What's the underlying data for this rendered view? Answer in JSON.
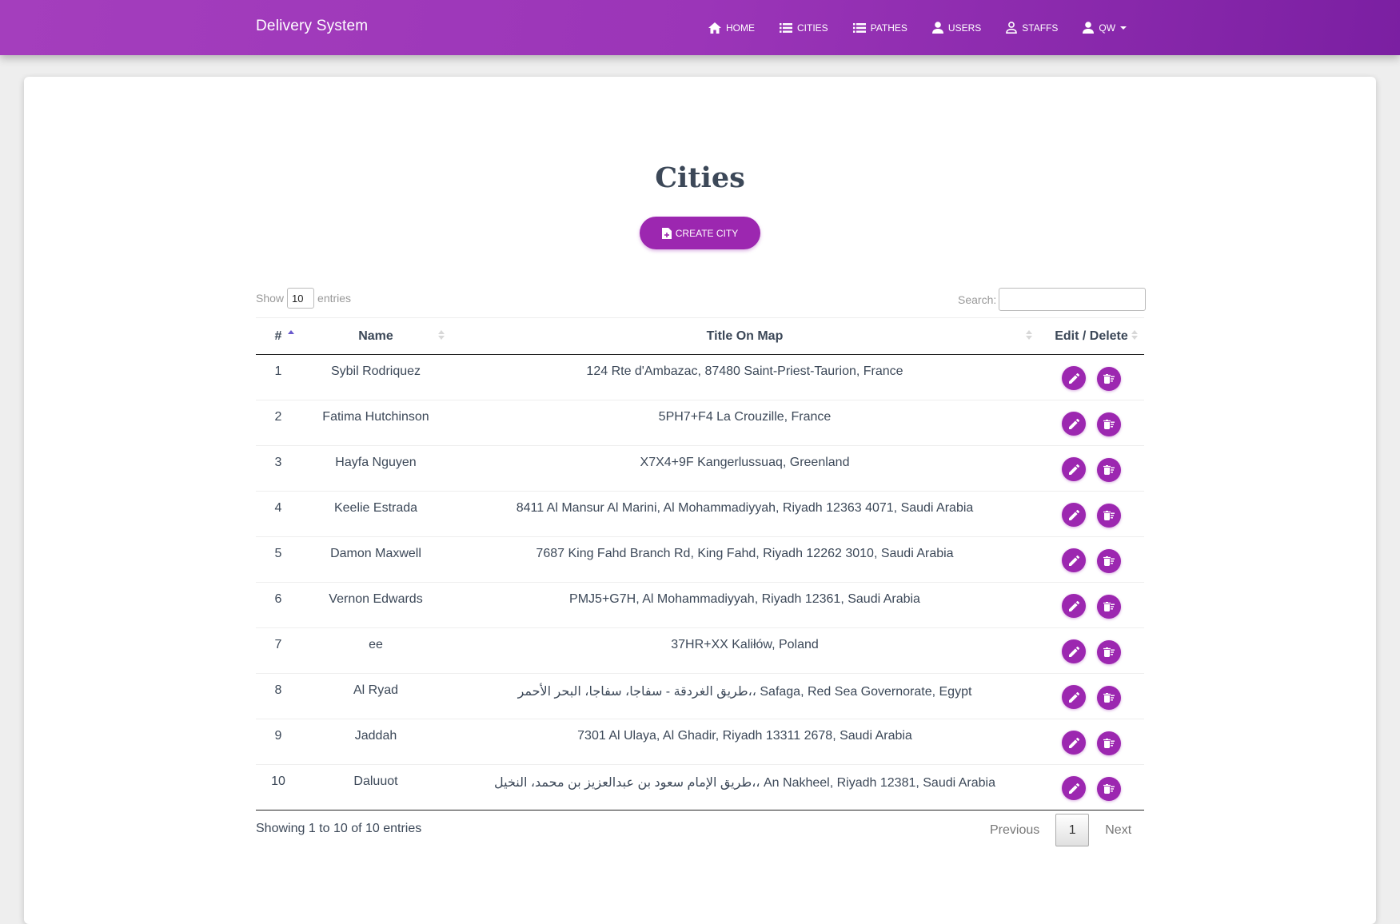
{
  "navbar": {
    "brand": "Delivery System",
    "items": [
      {
        "label": "HOME",
        "icon": "home-icon"
      },
      {
        "label": "CITIES",
        "icon": "list-icon"
      },
      {
        "label": "PATHES",
        "icon": "list-icon"
      },
      {
        "label": "USERS",
        "icon": "person-icon"
      },
      {
        "label": "STAFFS",
        "icon": "person-outline-icon"
      },
      {
        "label": "QW",
        "icon": "person-icon"
      }
    ]
  },
  "page": {
    "title": "Cities",
    "create_button": "CREATE CITY"
  },
  "controls": {
    "show_label": "Show",
    "entries_value": "10",
    "entries_label": "entries",
    "search_label": "Search:",
    "search_value": ""
  },
  "table": {
    "headers": [
      "#",
      "Name",
      "Title On Map",
      "Edit / Delete"
    ],
    "rows": [
      {
        "idx": "1",
        "name": "Sybil Rodriquez",
        "title": "124 Rte d'Ambazac, 87480 Saint-Priest-Taurion, France"
      },
      {
        "idx": "2",
        "name": "Fatima Hutchinson",
        "title": "5PH7+F4 La Crouzille, France"
      },
      {
        "idx": "3",
        "name": "Hayfa Nguyen",
        "title": "X7X4+9F Kangerlussuaq, Greenland"
      },
      {
        "idx": "4",
        "name": "Keelie Estrada",
        "title": "8411 Al Mansur Al Marini, Al Mohammadiyyah, Riyadh 12363 4071, Saudi Arabia"
      },
      {
        "idx": "5",
        "name": "Damon Maxwell",
        "title": "7687 King Fahd Branch Rd, King Fahd, Riyadh 12262 3010, Saudi Arabia"
      },
      {
        "idx": "6",
        "name": "Vernon Edwards",
        "title": "PMJ5+G7H, Al Mohammadiyyah, Riyadh 12361, Saudi Arabia"
      },
      {
        "idx": "7",
        "name": "ee",
        "title": "37HR+XX Kaliłów, Poland"
      },
      {
        "idx": "8",
        "name": "Al Ryad",
        "title": "طريق الغردقة - سفاجا، سفاجا، البحر الأحمر،، Safaga, Red Sea Governorate, Egypt"
      },
      {
        "idx": "9",
        "name": "Jaddah",
        "title": "7301 Al Ulaya, Al Ghadir, Riyadh 13311 2678, Saudi Arabia"
      },
      {
        "idx": "10",
        "name": "Daluuot",
        "title": "طريق الإمام سعود بن عبدالعزيز بن محمد، النخيل،، An Nakheel, Riyadh 12381, Saudi Arabia"
      }
    ]
  },
  "footer": {
    "info": "Showing 1 to 10 of 10 entries",
    "previous": "Previous",
    "current_page": "1",
    "next": "Next"
  },
  "colors": {
    "primary": "#9c27b0",
    "navbar_start": "#a43ebd",
    "navbar_end": "#7b1fa2",
    "title": "#3c4858"
  }
}
